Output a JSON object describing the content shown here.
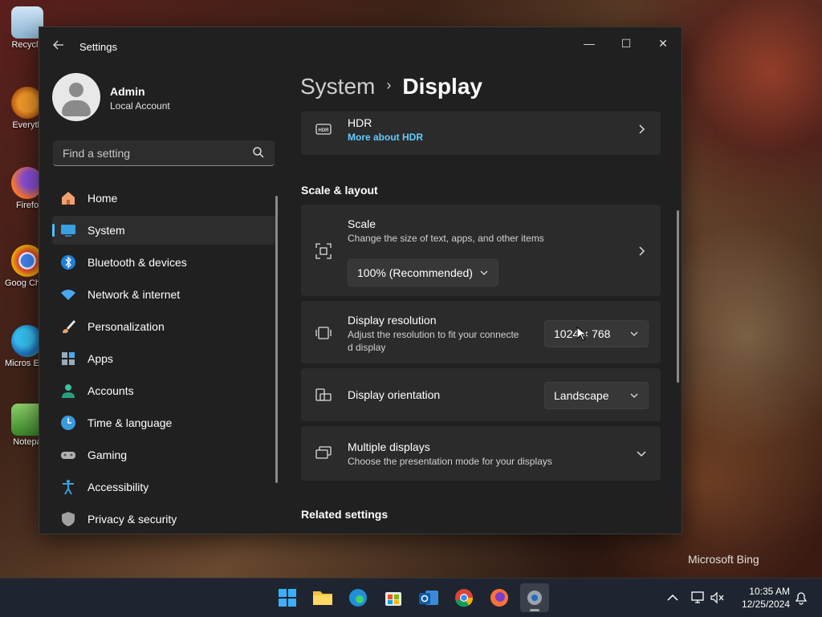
{
  "desktop": {
    "icons": [
      {
        "label": "Recycle"
      },
      {
        "label": "Everyth"
      },
      {
        "label": "Firefo"
      },
      {
        "label": "Goog Chron"
      },
      {
        "label": "Micros Edge"
      },
      {
        "label": "Notepa"
      }
    ],
    "watermark": "Microsoft Bing"
  },
  "window": {
    "title": "Settings",
    "controls": {
      "minimize": "—",
      "maximize": "☐",
      "close": "✕"
    }
  },
  "user": {
    "name": "Admin",
    "account_type": "Local Account"
  },
  "search": {
    "placeholder": "Find a setting"
  },
  "sidebar": {
    "items": [
      {
        "label": "Home",
        "icon": "home-icon"
      },
      {
        "label": "System",
        "icon": "monitor-icon",
        "active": true
      },
      {
        "label": "Bluetooth & devices",
        "icon": "bluetooth-icon"
      },
      {
        "label": "Network & internet",
        "icon": "wifi-icon"
      },
      {
        "label": "Personalization",
        "icon": "brush-icon"
      },
      {
        "label": "Apps",
        "icon": "apps-icon"
      },
      {
        "label": "Accounts",
        "icon": "person-icon"
      },
      {
        "label": "Time & language",
        "icon": "globe-clock-icon"
      },
      {
        "label": "Gaming",
        "icon": "gamepad-icon"
      },
      {
        "label": "Accessibility",
        "icon": "accessibility-icon"
      },
      {
        "label": "Privacy & security",
        "icon": "shield-icon"
      }
    ]
  },
  "breadcrumb": {
    "parent": "System",
    "separator": "›",
    "current": "Display"
  },
  "hdr": {
    "title": "HDR",
    "link": "More about HDR"
  },
  "scale_layout": {
    "heading": "Scale & layout",
    "scale": {
      "title": "Scale",
      "description": "Change the size of text, apps, and other items",
      "value": "100% (Recommended)"
    },
    "resolution": {
      "title": "Display resolution",
      "description_line1": "Adjust the resolution to fit your connecte",
      "description_line2": "d display",
      "value": "1024 × 768"
    },
    "orientation": {
      "title": "Display orientation",
      "value": "Landscape"
    },
    "multiple": {
      "title": "Multiple displays",
      "description": "Choose the presentation mode for your displays"
    }
  },
  "related": {
    "heading": "Related settings"
  },
  "taskbar": {
    "apps": [
      "start-icon",
      "file-explorer-icon",
      "edge-icon",
      "store-icon",
      "outlook-icon",
      "chrome-icon",
      "firefox-icon",
      "settings-icon"
    ],
    "time": "10:35 AM",
    "date": "12/25/2024"
  },
  "colors": {
    "accent": "#4cc2ff",
    "link": "#60cdff",
    "window_bg": "#202020",
    "card_bg": "#2b2b2b"
  }
}
